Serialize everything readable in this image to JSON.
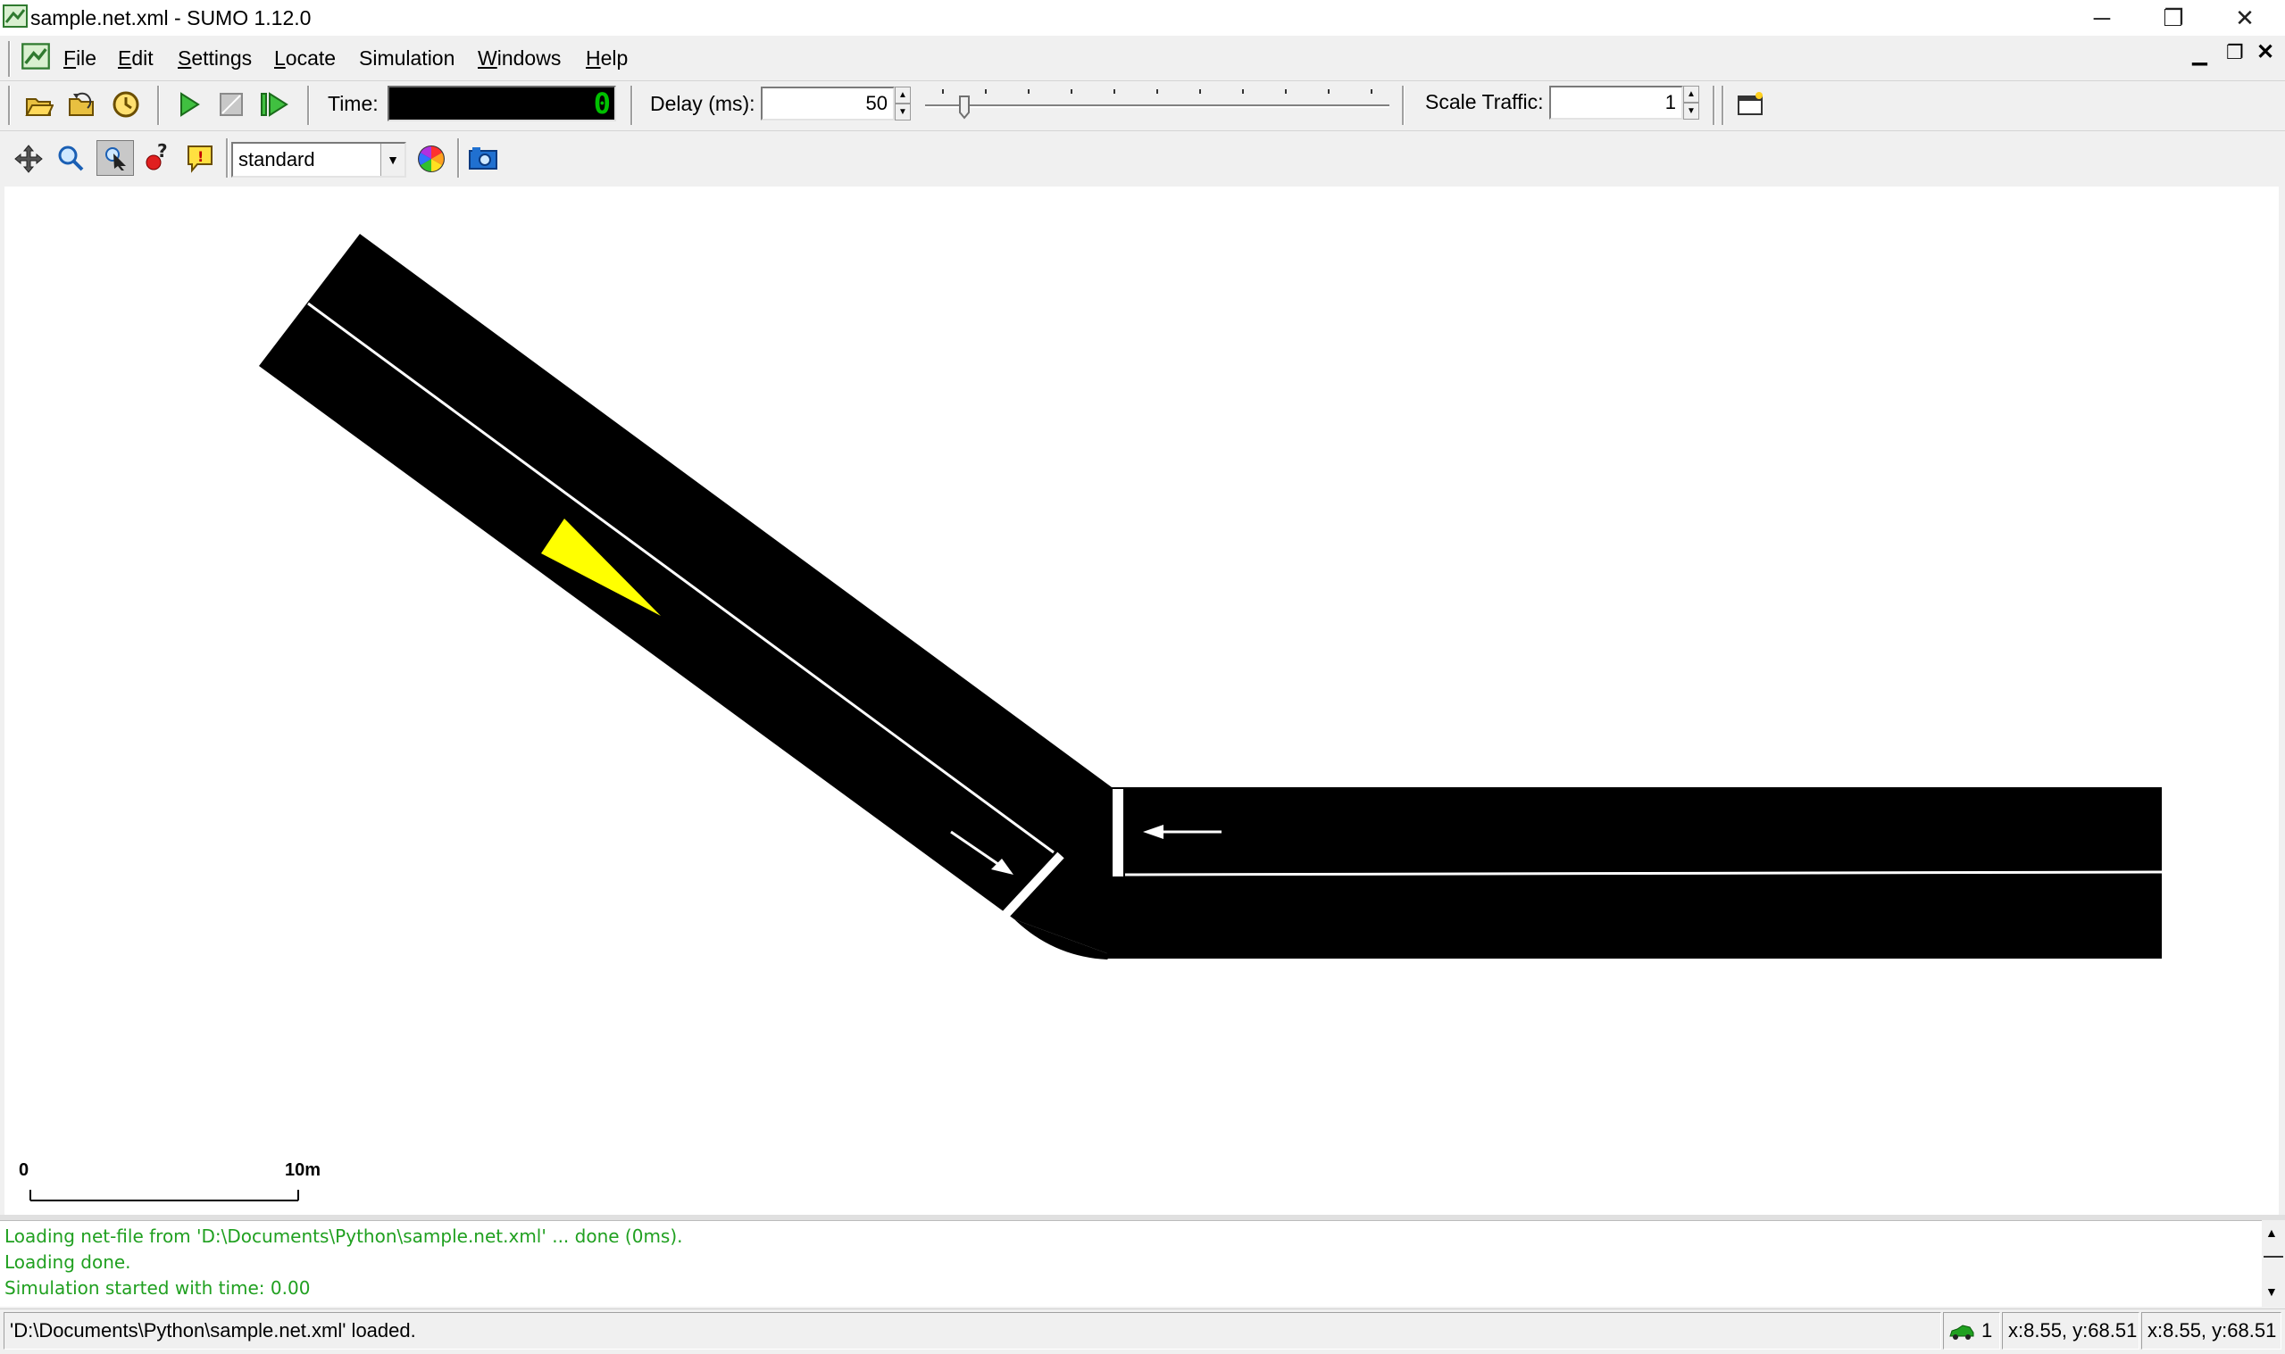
{
  "window": {
    "title": "sample.net.xml - SUMO 1.12.0",
    "minimize": "─",
    "restore": "❐",
    "close": "✕"
  },
  "menu": [
    {
      "label": "File",
      "u": "F",
      "rest": "ile"
    },
    {
      "label": "Edit",
      "u": "E",
      "rest": "dit"
    },
    {
      "label": "Settings",
      "u": "S",
      "rest": "ettings"
    },
    {
      "label": "Locate",
      "u": "L",
      "rest": "ocate"
    },
    {
      "label": "Simulation",
      "u": "",
      "rest": "Simulation"
    },
    {
      "label": "Windows",
      "u": "W",
      "rest": "indows"
    },
    {
      "label": "Help",
      "u": "H",
      "rest": "elp"
    }
  ],
  "toolbar": {
    "time_label": "Time:",
    "time_value": "0",
    "delay_label": "Delay (ms):",
    "delay_value": "50",
    "delay_slider_value": 0.05,
    "scale_label": "Scale Traffic:",
    "scale_value": "1"
  },
  "view_toolbar": {
    "scheme": "standard"
  },
  "scale_bar": {
    "start": "0",
    "end": "10m"
  },
  "messages": [
    "Loading net-file from 'D:\\Documents\\Python\\sample.net.xml' ... done (0ms).",
    "Loading done.",
    "Simulation started with time: 0.00"
  ],
  "status": {
    "text": "'D:\\Documents\\Python\\sample.net.xml' loaded.",
    "vehicle_count": "1",
    "coords_1": "x:8.55, y:68.51",
    "coords_2": "x:8.55, y:68.51"
  },
  "colors": {
    "road": "#000000",
    "lane_marking": "#ffffff",
    "vehicle": "#ffff00",
    "message_text": "#20a020",
    "time_display_bg": "#000000",
    "time_digits": "#00c000"
  },
  "icons": [
    "app-icon",
    "open-icon",
    "reload-icon",
    "recent-icon",
    "play-icon",
    "stop-icon",
    "step-icon",
    "new-view-icon",
    "recenter-icon",
    "zoom-icon",
    "select-icon",
    "locate-icon",
    "info-icon",
    "color-wheel-icon",
    "camera-icon",
    "car-icon"
  ]
}
